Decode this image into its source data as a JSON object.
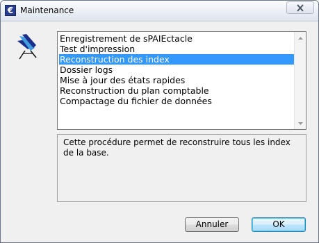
{
  "window": {
    "title": "Maintenance",
    "app_icon_glyph": "€",
    "close_icon": "close-icon"
  },
  "options_list": {
    "items": [
      "Enregistrement de sPAIEctacle",
      "Test d'impression",
      "Reconstruction des index",
      "Dossier logs",
      "Mise à jour des états rapides",
      "Reconstruction du plan comptable",
      "Compactage du fichier de données"
    ],
    "selected_index": 2
  },
  "description": {
    "text": "Cette procédure permet de reconstruire tous les index de la base."
  },
  "buttons": {
    "cancel_label": "Annuler",
    "ok_label": "OK"
  },
  "colors": {
    "selection": "#3399ff",
    "window_bg": "#f0f0f0"
  }
}
